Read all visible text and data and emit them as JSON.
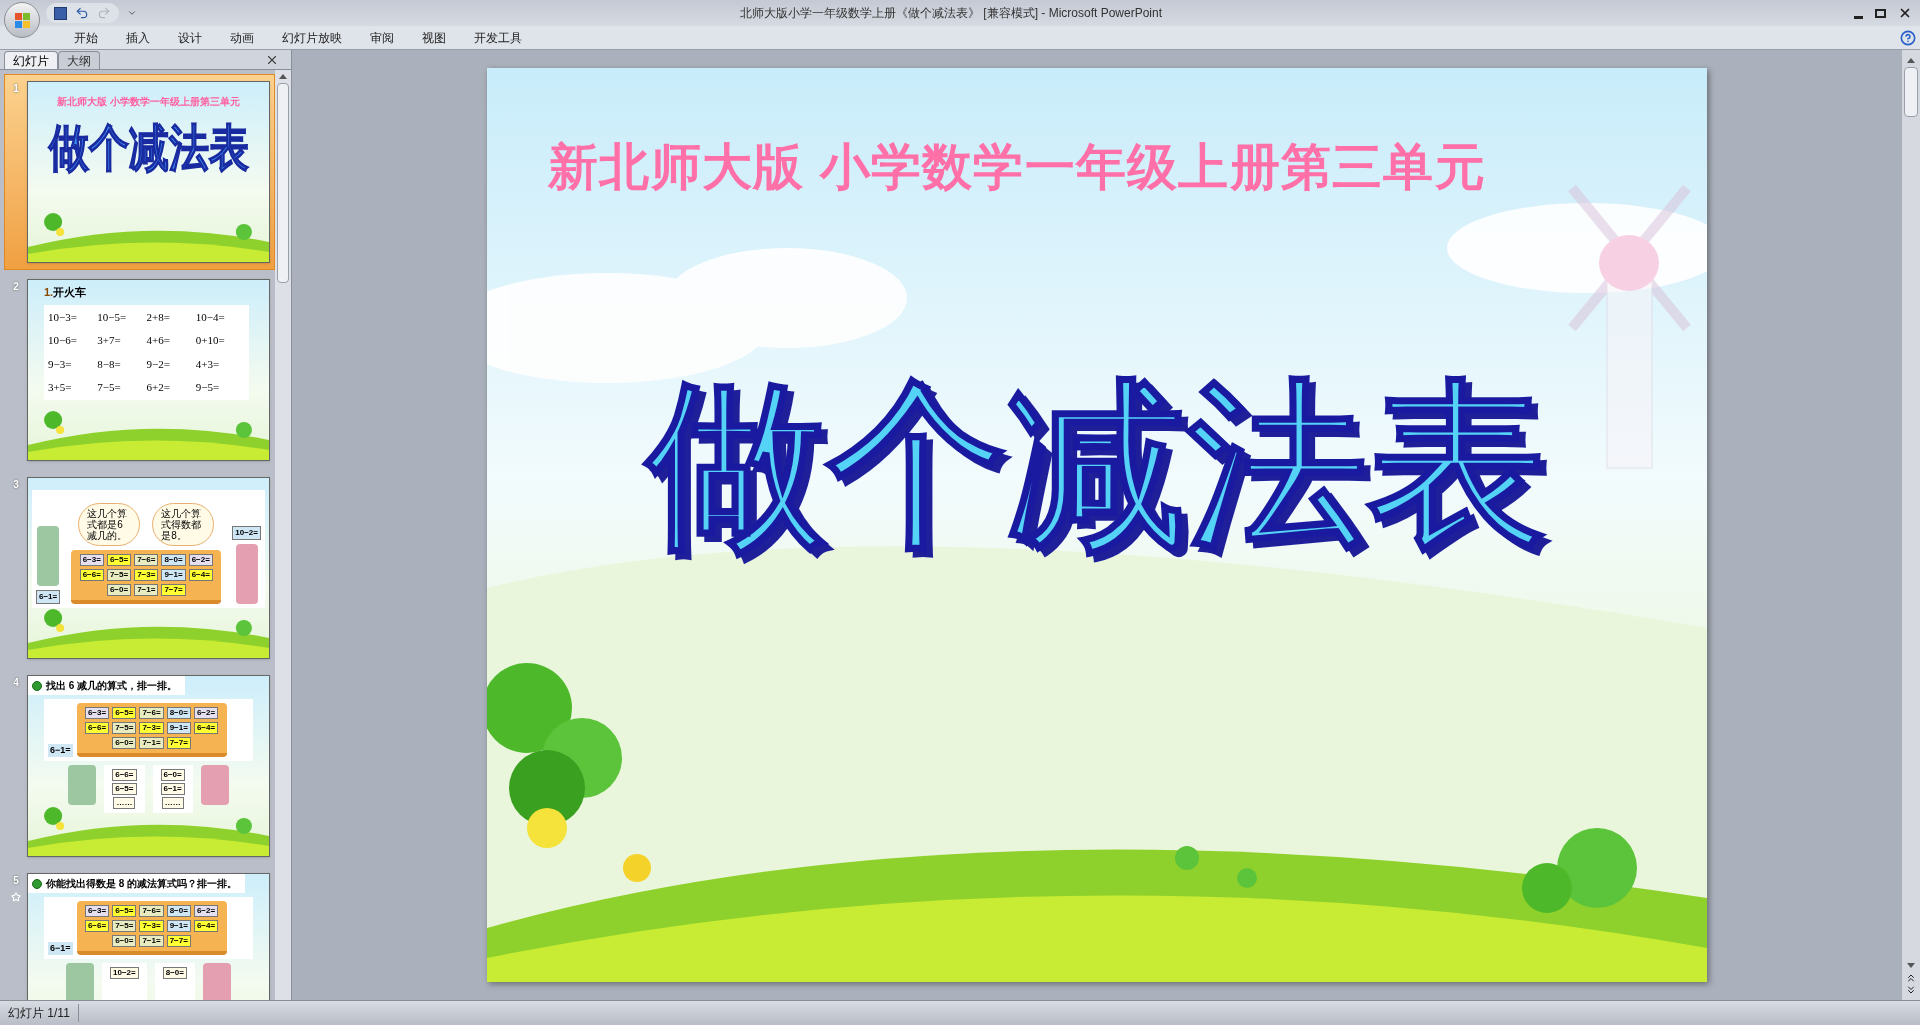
{
  "window": {
    "title": "北师大版小学一年级数学上册《做个减法表》 [兼容模式] - Microsoft PowerPoint"
  },
  "ribbon_tabs": [
    "开始",
    "插入",
    "设计",
    "动画",
    "幻灯片放映",
    "审阅",
    "视图",
    "开发工具"
  ],
  "panel_tabs": [
    {
      "label": "幻灯片",
      "selected": true
    },
    {
      "label": "大纲",
      "selected": false
    }
  ],
  "thumbnails": [
    {
      "number": "1",
      "selected": true,
      "animated": false,
      "kind": "title",
      "subtitle": "新北师大版 小学数学一年级上册第三单元",
      "title": "做个减法表"
    },
    {
      "number": "2",
      "selected": false,
      "animated": false,
      "kind": "equations",
      "heading_number": "1.",
      "heading": "开火车",
      "equations": [
        "10−3=",
        "10−5=",
        "2+8=",
        "10−4=",
        "10−6=",
        "3+7=",
        "4+6=",
        "0+10=",
        "9−3=",
        "8−8=",
        "9−2=",
        "4+3=",
        "3+5=",
        "7−5=",
        "6+2=",
        "9−5="
      ]
    },
    {
      "number": "3",
      "selected": false,
      "animated": false,
      "kind": "board",
      "bubbles": [
        "这几个算式都是6减几的。",
        "这几个算式得数都是8。"
      ],
      "held_cards": [
        "6−1=",
        "10−2="
      ],
      "cards": [
        {
          "text": "6−3=",
          "color": "#e6dff0"
        },
        {
          "text": "6−5=",
          "color": "#ffff33"
        },
        {
          "text": "7−6=",
          "color": "#e8ecc0"
        },
        {
          "text": "8−0=",
          "color": "#cfe6f5"
        },
        {
          "text": "6−2=",
          "color": "#e6dff0"
        },
        {
          "text": "6−6=",
          "color": "#ffff33"
        },
        {
          "text": "7−5=",
          "color": "#e8ecc0"
        },
        {
          "text": "7−3=",
          "color": "#ffff33"
        },
        {
          "text": "9−1=",
          "color": "#cfe6f5"
        },
        {
          "text": "6−4=",
          "color": "#ffff33"
        },
        {
          "text": "6−0=",
          "color": "#e8ecc0"
        },
        {
          "text": "7−1=",
          "color": "#e8ecc0"
        },
        {
          "text": "7−7=",
          "color": "#ffff33"
        }
      ]
    },
    {
      "number": "4",
      "selected": false,
      "animated": false,
      "kind": "sorting",
      "heading": "找出 6 减几的算式，排一排。",
      "held_card": "6−1=",
      "lists": [
        [
          "6−6=",
          "6−5=",
          "……"
        ],
        [
          "6−0=",
          "6−1=",
          "……"
        ]
      ],
      "cards": [
        {
          "text": "6−3=",
          "color": "#e6dff0"
        },
        {
          "text": "6−5=",
          "color": "#ffff33"
        },
        {
          "text": "7−6=",
          "color": "#e8ecc0"
        },
        {
          "text": "8−0=",
          "color": "#cfe6f5"
        },
        {
          "text": "6−2=",
          "color": "#e6dff0"
        },
        {
          "text": "6−6=",
          "color": "#ffff33"
        },
        {
          "text": "7−5=",
          "color": "#e8ecc0"
        },
        {
          "text": "7−3=",
          "color": "#ffff33"
        },
        {
          "text": "9−1=",
          "color": "#cfe6f5"
        },
        {
          "text": "6−4=",
          "color": "#ffff33"
        },
        {
          "text": "6−0=",
          "color": "#e8ecc0"
        },
        {
          "text": "7−1=",
          "color": "#e8ecc0"
        },
        {
          "text": "7−7=",
          "color": "#ffff33"
        }
      ]
    },
    {
      "number": "5",
      "selected": false,
      "animated": true,
      "kind": "sorting",
      "heading": "你能找出得数是 8 的减法算式吗？排一排。",
      "held_card": "6−1=",
      "lists": [
        [
          "10−2="
        ],
        [
          "8−0="
        ]
      ],
      "cards": [
        {
          "text": "6−3=",
          "color": "#e6dff0"
        },
        {
          "text": "6−5=",
          "color": "#ffff33"
        },
        {
          "text": "7−6=",
          "color": "#e8ecc0"
        },
        {
          "text": "8−0=",
          "color": "#cfe6f5"
        },
        {
          "text": "6−2=",
          "color": "#e6dff0"
        },
        {
          "text": "6−6=",
          "color": "#ffff33"
        },
        {
          "text": "7−5=",
          "color": "#e8ecc0"
        },
        {
          "text": "7−3=",
          "color": "#ffff33"
        },
        {
          "text": "9−1=",
          "color": "#cfe6f5"
        },
        {
          "text": "6−4=",
          "color": "#ffff33"
        },
        {
          "text": "6−0=",
          "color": "#e8ecc0"
        },
        {
          "text": "7−1=",
          "color": "#e8ecc0"
        },
        {
          "text": "7−7=",
          "color": "#ffff33"
        }
      ]
    }
  ],
  "slide": {
    "subtitle": "新北师大版 小学数学一年级上册第三单元",
    "title": "做个减法表"
  },
  "status_bar": {
    "slide_counter": "幻灯片 1/11"
  }
}
